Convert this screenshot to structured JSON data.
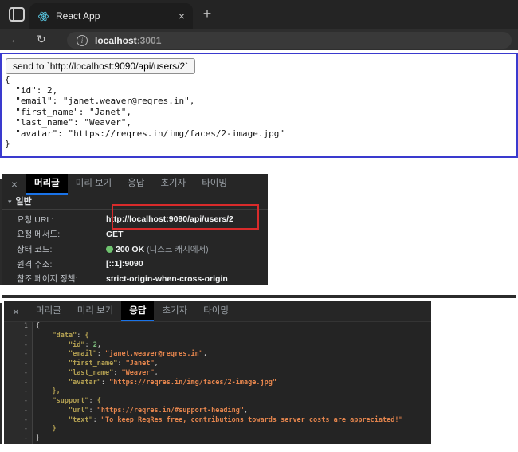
{
  "browser": {
    "tab_title": "React App",
    "close_glyph": "×",
    "new_tab_glyph": "+",
    "back_glyph": "←",
    "reload_glyph": "↻",
    "info_glyph": "i",
    "url_host": "localhost",
    "url_port": ":3001"
  },
  "page": {
    "button_label": "send to `http://localhost:9090/api/users/2`",
    "json_text": "{\n  \"id\": 2,\n  \"email\": \"janet.weaver@reqres.in\",\n  \"first_name\": \"Janet\",\n  \"last_name\": \"Weaver\",\n  \"avatar\": \"https://reqres.in/img/faces/2-image.jpg\"\n}"
  },
  "devtools": {
    "close_glyph": "×",
    "tabs": [
      "머리글",
      "미리 보기",
      "응답",
      "초기자",
      "타이밍"
    ],
    "headers_panel": {
      "active_tab": "머리글",
      "section_arrow": "▾",
      "section_label": "일반",
      "rows": [
        {
          "label": "요청 URL:",
          "value": "http://localhost:9090/api/users/2",
          "highlighted": true
        },
        {
          "label": "요청 메서드:",
          "value": "GET"
        },
        {
          "label": "상태 코드:",
          "value": "200 OK",
          "suffix": " (디스크 캐시에서)",
          "status_dot": true
        },
        {
          "label": "원격 주소:",
          "value": "[::1]:9090"
        },
        {
          "label": "참조 페이지 정책:",
          "value": "strict-origin-when-cross-origin"
        }
      ]
    },
    "response_panel": {
      "active_tab": "응답",
      "lines": [
        {
          "g": "1",
          "s": [
            [
              "p",
              "{"
            ]
          ]
        },
        {
          "g": "-",
          "s": [
            [
              "p",
              "    "
            ],
            [
              "k",
              "\"data\""
            ],
            [
              "p",
              ": "
            ],
            [
              "b",
              "{"
            ]
          ]
        },
        {
          "g": "-",
          "s": [
            [
              "p",
              "        "
            ],
            [
              "k",
              "\"id\""
            ],
            [
              "p",
              ": "
            ],
            [
              "n",
              "2"
            ],
            [
              "p",
              ","
            ]
          ]
        },
        {
          "g": "-",
          "s": [
            [
              "p",
              "        "
            ],
            [
              "k",
              "\"email\""
            ],
            [
              "p",
              ": "
            ],
            [
              "s",
              "\"janet.weaver@reqres.in\""
            ],
            [
              "p",
              ","
            ]
          ]
        },
        {
          "g": "-",
          "s": [
            [
              "p",
              "        "
            ],
            [
              "k",
              "\"first_name\""
            ],
            [
              "p",
              ": "
            ],
            [
              "s",
              "\"Janet\""
            ],
            [
              "p",
              ","
            ]
          ]
        },
        {
          "g": "-",
          "s": [
            [
              "p",
              "        "
            ],
            [
              "k",
              "\"last_name\""
            ],
            [
              "p",
              ": "
            ],
            [
              "s",
              "\"Weaver\""
            ],
            [
              "p",
              ","
            ]
          ]
        },
        {
          "g": "-",
          "s": [
            [
              "p",
              "        "
            ],
            [
              "k",
              "\"avatar\""
            ],
            [
              "p",
              ": "
            ],
            [
              "s",
              "\"https://reqres.in/img/faces/2-image.jpg\""
            ]
          ]
        },
        {
          "g": "-",
          "s": [
            [
              "p",
              "    "
            ],
            [
              "b",
              "},"
            ]
          ]
        },
        {
          "g": "-",
          "s": [
            [
              "p",
              "    "
            ],
            [
              "k",
              "\"support\""
            ],
            [
              "p",
              ": "
            ],
            [
              "b",
              "{"
            ]
          ]
        },
        {
          "g": "-",
          "s": [
            [
              "p",
              "        "
            ],
            [
              "k",
              "\"url\""
            ],
            [
              "p",
              ": "
            ],
            [
              "s",
              "\"https://reqres.in/#support-heading\""
            ],
            [
              "p",
              ","
            ]
          ]
        },
        {
          "g": "-",
          "s": [
            [
              "p",
              "        "
            ],
            [
              "k",
              "\"text\""
            ],
            [
              "p",
              ": "
            ],
            [
              "s",
              "\"To keep ReqRes free, contributions towards server costs are appreciated!\""
            ]
          ]
        },
        {
          "g": "-",
          "s": [
            [
              "p",
              "    "
            ],
            [
              "b",
              "}"
            ]
          ]
        },
        {
          "g": "-",
          "s": [
            [
              "p",
              "}"
            ]
          ]
        }
      ]
    }
  },
  "colors": {
    "content_border_blue": "#3a3ace",
    "accent_tab_underline": "#1a73e8",
    "json_key": "#b3a052",
    "json_string": "#e5854d",
    "json_number": "#7dbd7d",
    "status_dot_green": "#6fc36f",
    "highlight_red": "#d92b2b",
    "react_logo_cyan": "#5ed3f0"
  }
}
